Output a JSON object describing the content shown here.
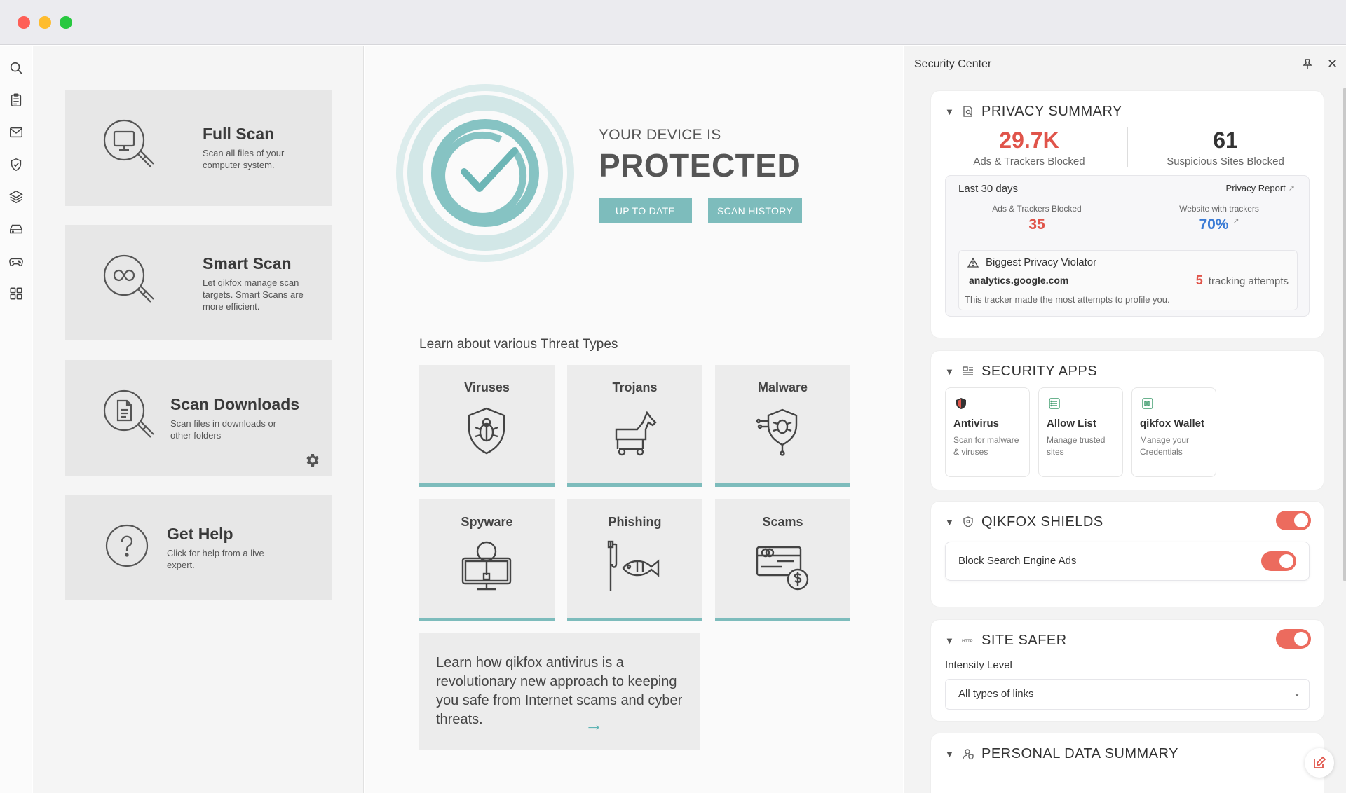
{
  "window": {
    "controls": [
      "close",
      "minimize",
      "maximize"
    ]
  },
  "rail": {
    "icons": [
      "search-icon",
      "clipboard-icon",
      "mail-icon",
      "shield-icon",
      "layers-icon",
      "drive-icon",
      "gamepad-icon",
      "apps-grid-icon"
    ]
  },
  "scans": [
    {
      "title": "Full Scan",
      "desc": "Scan all files of your computer system.",
      "icon": "monitor-magnifier-icon"
    },
    {
      "title": "Smart Scan",
      "desc": "Let qikfox manage scan targets. Smart Scans are more efficient.",
      "icon": "infinity-magnifier-icon"
    },
    {
      "title": "Scan Downloads",
      "desc": "Scan files in downloads or other folders",
      "icon": "document-magnifier-icon"
    },
    {
      "title": "Get Help",
      "desc": "Click for help from a live expert.",
      "icon": "question-icon"
    }
  ],
  "status": {
    "top": "YOUR DEVICE IS",
    "main": "PROTECTED",
    "btn_uptodate": "UP TO DATE",
    "btn_history": "SCAN HISTORY"
  },
  "threats": {
    "heading": "Learn about various Threat Types",
    "items": [
      {
        "name": "Viruses",
        "icon": "virus-shield-icon"
      },
      {
        "name": "Trojans",
        "icon": "trojan-horse-icon"
      },
      {
        "name": "Malware",
        "icon": "malware-icon"
      },
      {
        "name": "Spyware",
        "icon": "spyware-icon"
      },
      {
        "name": "Phishing",
        "icon": "phishing-icon"
      },
      {
        "name": "Scams",
        "icon": "scam-card-icon"
      }
    ],
    "promo": "Learn how qikfox antivirus is a revolutionary new approach to keeping you safe from Internet scams and cyber threats.",
    "promo_arrow": "→"
  },
  "security_center": {
    "title": "Security Center",
    "privacy": {
      "title": "PRIVACY SUMMARY",
      "ads_value": "29.7K",
      "ads_label": "Ads & Trackers Blocked",
      "sites_value": "61",
      "sites_label": "Suspicious Sites Blocked",
      "period": "Last 30 days",
      "report_link": "Privacy Report",
      "period_ads_label": "Ads & Trackers Blocked",
      "period_ads_value": "35",
      "period_web_label": "Website with trackers",
      "period_web_value": "70%",
      "violator_title": "Biggest Privacy Violator",
      "violator_domain": "analytics.google.com",
      "violator_count": "5",
      "violator_unit": "tracking attempts",
      "violator_note": "This tracker made the most attempts to profile you."
    },
    "apps": {
      "title": "SECURITY APPS",
      "items": [
        {
          "name": "Antivirus",
          "desc": "Scan for malware & viruses",
          "icon": "antivirus-shield-icon"
        },
        {
          "name": "Allow List",
          "desc": "Manage trusted sites",
          "icon": "list-icon"
        },
        {
          "name": "qikfox Wallet",
          "desc": "Manage your Credentials",
          "icon": "wallet-icon"
        }
      ]
    },
    "shields": {
      "title": "QIKFOX SHIELDS",
      "enabled": true,
      "option_label": "Block Search Engine Ads",
      "option_enabled": true
    },
    "site_safer": {
      "title": "SITE SAFER",
      "enabled": true,
      "intensity_label": "Intensity Level",
      "intensity_value": "All types of links"
    },
    "personal": {
      "title": "PERSONAL DATA SUMMARY"
    }
  },
  "colors": {
    "accent_teal": "#7dbcbc",
    "accent_red": "#e0544a",
    "accent_blue": "#3a7bd5",
    "toggle_on": "#ec6b5e"
  }
}
